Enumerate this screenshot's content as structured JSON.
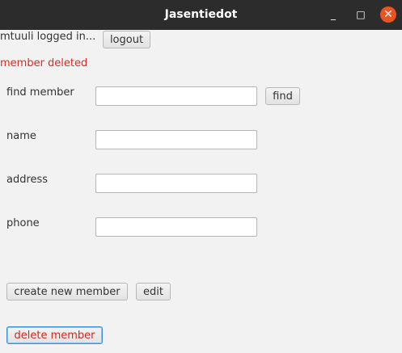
{
  "window": {
    "title": "Jasentiedot",
    "minimize_glyph": "_",
    "maximize_glyph": "□",
    "close_glyph": "✕"
  },
  "session": {
    "logged_in_text": "mtuuli logged in...",
    "logout_label": "logout"
  },
  "status": {
    "message": "member deleted",
    "color": "#e0291f"
  },
  "form": {
    "find_label": "find member",
    "find_value": "",
    "find_button": "find",
    "name_label": "name",
    "name_value": "",
    "address_label": "address",
    "address_value": "",
    "phone_label": "phone",
    "phone_value": ""
  },
  "actions": {
    "create_label": "create new member",
    "edit_label": "edit",
    "delete_label": "delete member"
  }
}
